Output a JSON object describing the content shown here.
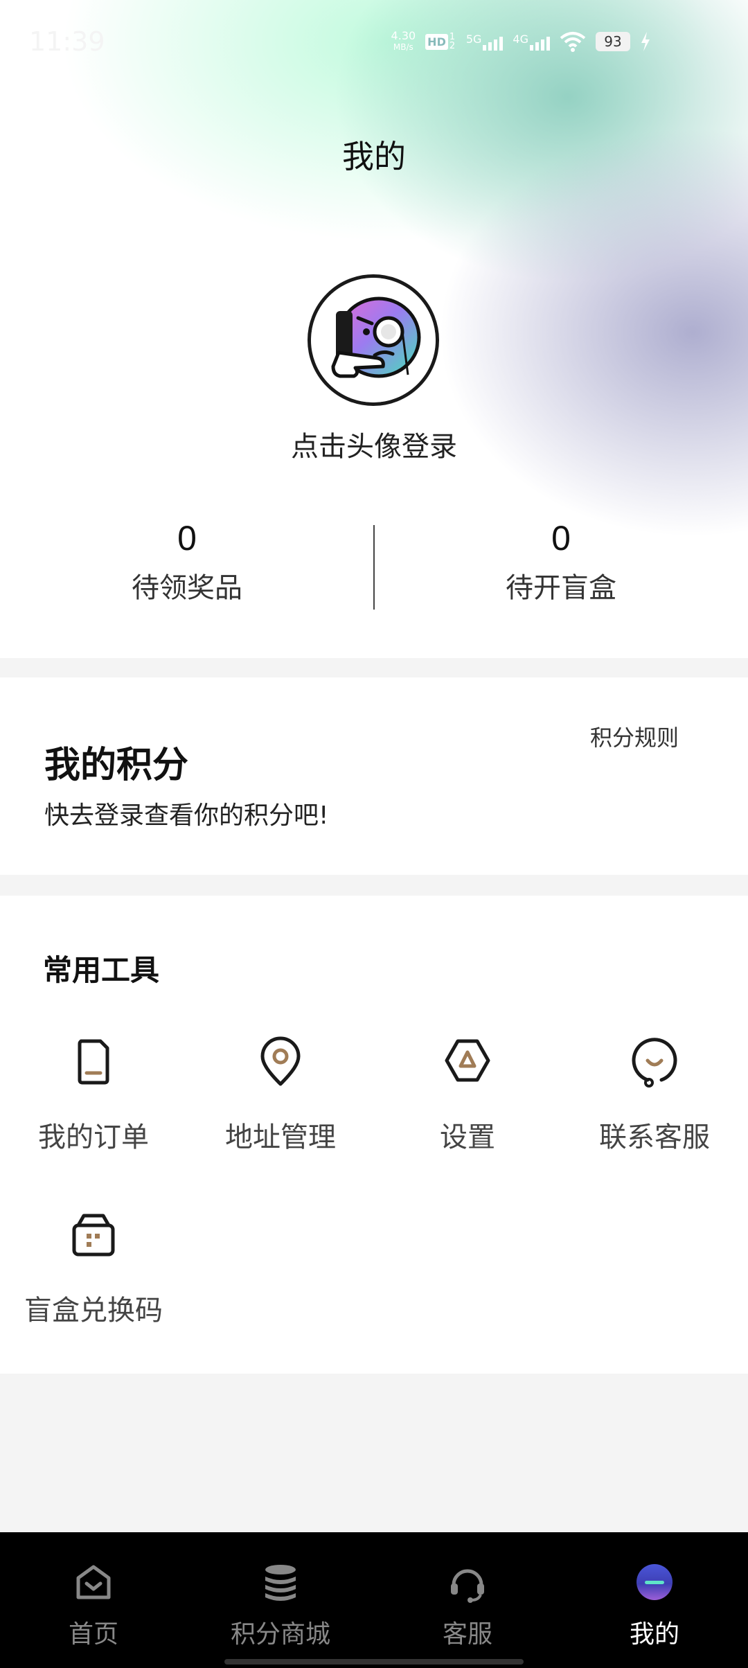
{
  "status_bar": {
    "time": "11:39",
    "speed": "4.30",
    "speed_unit": "MB/s",
    "hd_label": "HD",
    "hd_sim": "1 2",
    "net1": "5G",
    "net2": "4G",
    "battery": "93"
  },
  "header": {
    "title": "我的"
  },
  "profile": {
    "login_prompt": "点击头像登录"
  },
  "stats": [
    {
      "value": "0",
      "label": "待领奖品"
    },
    {
      "value": "0",
      "label": "待开盲盒"
    }
  ],
  "points": {
    "title": "我的积分",
    "subtitle": "快去登录查看你的积分吧!",
    "rules_link": "积分规则"
  },
  "tools": {
    "title": "常用工具",
    "items": [
      {
        "label": "我的订单",
        "icon": "order-icon"
      },
      {
        "label": "地址管理",
        "icon": "location-pin-icon"
      },
      {
        "label": "设置",
        "icon": "settings-icon"
      },
      {
        "label": "联系客服",
        "icon": "customer-service-icon"
      },
      {
        "label": "盲盒兑换码",
        "icon": "blind-box-code-icon"
      }
    ]
  },
  "tabbar": {
    "items": [
      {
        "label": "首页",
        "icon": "home-icon",
        "active": false
      },
      {
        "label": "积分商城",
        "icon": "coins-stack-icon",
        "active": false
      },
      {
        "label": "客服",
        "icon": "headset-icon",
        "active": false
      },
      {
        "label": "我的",
        "icon": "profile-orb-icon",
        "active": true
      }
    ]
  },
  "colors": {
    "accent_brown": "#a07c56",
    "tabbar_bg": "#000000",
    "active_tab": "#ffffff",
    "inactive_tab": "#888888"
  }
}
